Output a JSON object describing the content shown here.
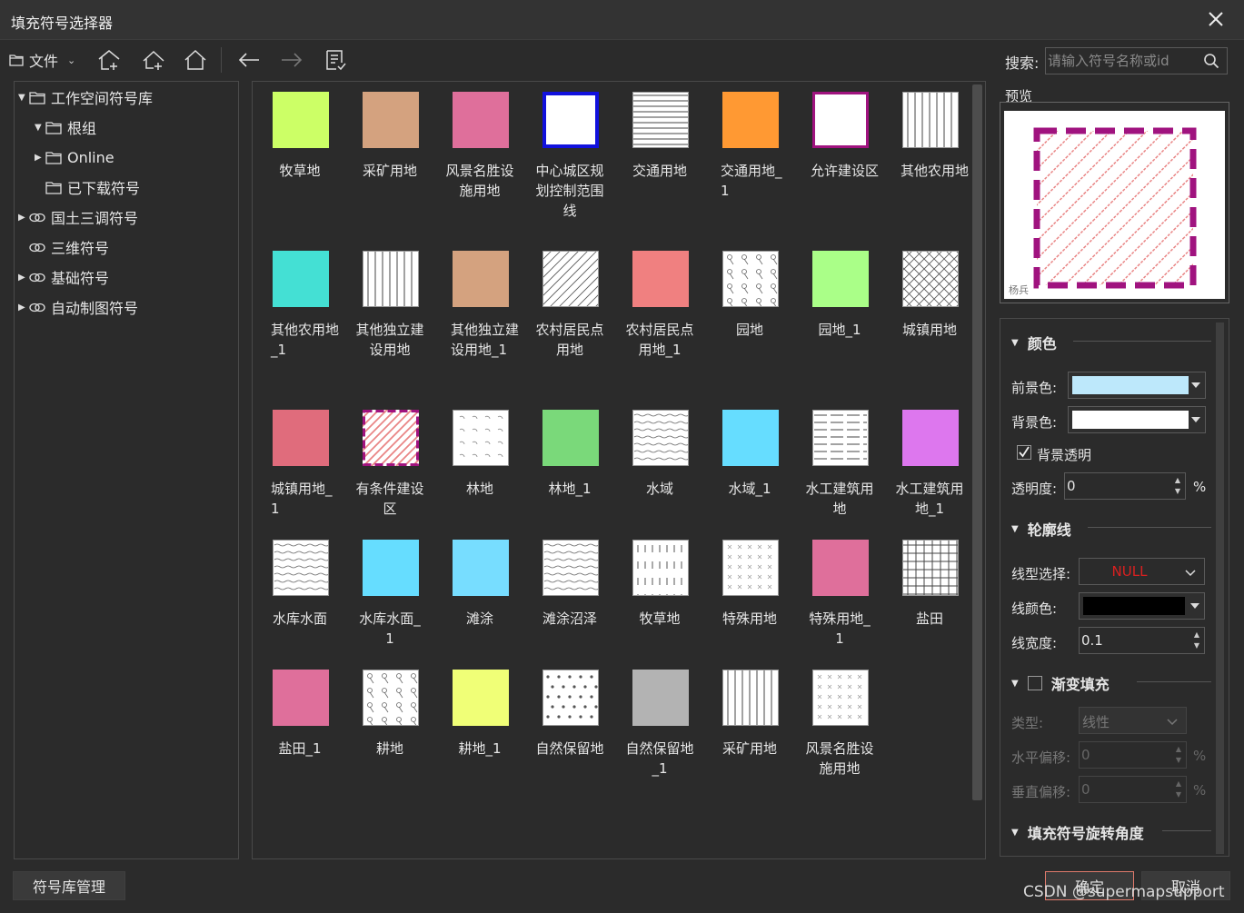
{
  "window": {
    "title": "填充符号选择器"
  },
  "toolbar": {
    "file_label": "文件",
    "search_label": "搜索:",
    "search_placeholder": "请输入符号名称或id"
  },
  "tree": [
    {
      "label": "工作空间符号库",
      "expanded": true
    },
    {
      "label": "根组",
      "expanded": true
    },
    {
      "label": "Online",
      "expanded": false
    },
    {
      "label": "已下载符号"
    },
    {
      "label": "国土三调符号",
      "expanded": false
    },
    {
      "label": "三维符号"
    },
    {
      "label": "基础符号",
      "expanded": false
    },
    {
      "label": "自动制图符号",
      "expanded": false
    }
  ],
  "symbols": [
    {
      "name": "牧草地",
      "color": "#ccff66",
      "pattern": "solid"
    },
    {
      "name": "采矿用地",
      "color": "#d4a27f",
      "pattern": "solid"
    },
    {
      "name": "风景名胜设施用地",
      "color": "#df6f9b",
      "pattern": "solid"
    },
    {
      "name": "中心城区规划控制范围线",
      "color": "#ffffff",
      "pattern": "blueborder"
    },
    {
      "name": "交通用地",
      "color": "#ffffff",
      "pattern": "hlines"
    },
    {
      "name": "交通用地_1",
      "color": "#ff9933",
      "pattern": "solid"
    },
    {
      "name": "允许建设区",
      "color": "#ffffff",
      "pattern": "purpleborder"
    },
    {
      "name": "其他农用地",
      "color": "#ffffff",
      "pattern": "vlines"
    },
    {
      "name": "其他农用地_1",
      "color": "#44e0d4",
      "pattern": "solid"
    },
    {
      "name": "其他独立建设用地",
      "color": "#ffffff",
      "pattern": "vlines"
    },
    {
      "name": "其他独立建设用地_1",
      "color": "#d4a27f",
      "pattern": "solid"
    },
    {
      "name": "农村居民点用地",
      "color": "#ffffff",
      "pattern": "diag"
    },
    {
      "name": "农村居民点用地_1",
      "color": "#f08080",
      "pattern": "solid"
    },
    {
      "name": "园地",
      "color": "#ffffff",
      "pattern": "orchard"
    },
    {
      "name": "园地_1",
      "color": "#aaff88",
      "pattern": "solid"
    },
    {
      "name": "城镇用地",
      "color": "#ffffff",
      "pattern": "cross"
    },
    {
      "name": "城镇用地_1",
      "color": "#e06c7c",
      "pattern": "solid"
    },
    {
      "name": "有条件建设区",
      "color": "#ffffff",
      "pattern": "dashdiag"
    },
    {
      "name": "林地",
      "color": "#ffffff",
      "pattern": "dots"
    },
    {
      "name": "林地_1",
      "color": "#7ad97a",
      "pattern": "solid"
    },
    {
      "name": "水域",
      "color": "#ffffff",
      "pattern": "waves"
    },
    {
      "name": "水域_1",
      "color": "#66ddff",
      "pattern": "solid"
    },
    {
      "name": "水工建筑用地",
      "color": "#ffffff",
      "pattern": "dashh"
    },
    {
      "name": "水工建筑用地_1",
      "color": "#dd77ee",
      "pattern": "solid"
    },
    {
      "name": "水库水面",
      "color": "#ffffff",
      "pattern": "waves"
    },
    {
      "name": "水库水面_1",
      "color": "#66ddff",
      "pattern": "solid"
    },
    {
      "name": "滩涂",
      "color": "#77ddff",
      "pattern": "solid"
    },
    {
      "name": "滩涂沼泽",
      "color": "#ffffff",
      "pattern": "waves"
    },
    {
      "name": "牧草地",
      "color": "#ffffff",
      "pattern": "ticks"
    },
    {
      "name": "特殊用地",
      "color": "#ffffff",
      "pattern": "xdots"
    },
    {
      "name": "特殊用地_1",
      "color": "#df6f9b",
      "pattern": "solid"
    },
    {
      "name": "盐田",
      "color": "#ffffff",
      "pattern": "grid"
    },
    {
      "name": "盐田_1",
      "color": "#df6f9b",
      "pattern": "solid"
    },
    {
      "name": "耕地",
      "color": "#ffffff",
      "pattern": "orchard"
    },
    {
      "name": "耕地_1",
      "color": "#f0ff77",
      "pattern": "solid"
    },
    {
      "name": "自然保留地",
      "color": "#ffffff",
      "pattern": "dots2"
    },
    {
      "name": "自然保留地_1",
      "color": "#b3b3b3",
      "pattern": "solid"
    },
    {
      "name": "采矿用地",
      "color": "#ffffff",
      "pattern": "vlines"
    },
    {
      "name": "风景名胜设施用地",
      "color": "#ffffff",
      "pattern": "xdots"
    }
  ],
  "preview": {
    "label": "预览",
    "watermark": "杨兵"
  },
  "props": {
    "color_section": "颜色",
    "fg_label": "前景色:",
    "fg_color": "#bde8fb",
    "bg_label": "背景色:",
    "bg_color": "#ffffff",
    "bg_transparent_label": "背景透明",
    "opacity_label": "透明度:",
    "opacity_value": "0",
    "percent": "%",
    "outline_section": "轮廓线",
    "linetype_label": "线型选择:",
    "linetype_value": "NULL",
    "linecolor_label": "线颜色:",
    "line_color": "#000000",
    "linewidth_label": "线宽度:",
    "linewidth_value": "0.1",
    "gradient_section": "渐变填充",
    "type_label": "类型:",
    "type_value": "线性",
    "hoffset_label": "水平偏移:",
    "hoffset_value": "0",
    "voffset_label": "垂直偏移:",
    "voffset_value": "0",
    "rotation_section": "填充符号旋转角度"
  },
  "footer": {
    "manage_label": "符号库管理",
    "ok_label": "确定",
    "cancel_label": "取消",
    "watermark": "CSDN @supermapsupport"
  }
}
